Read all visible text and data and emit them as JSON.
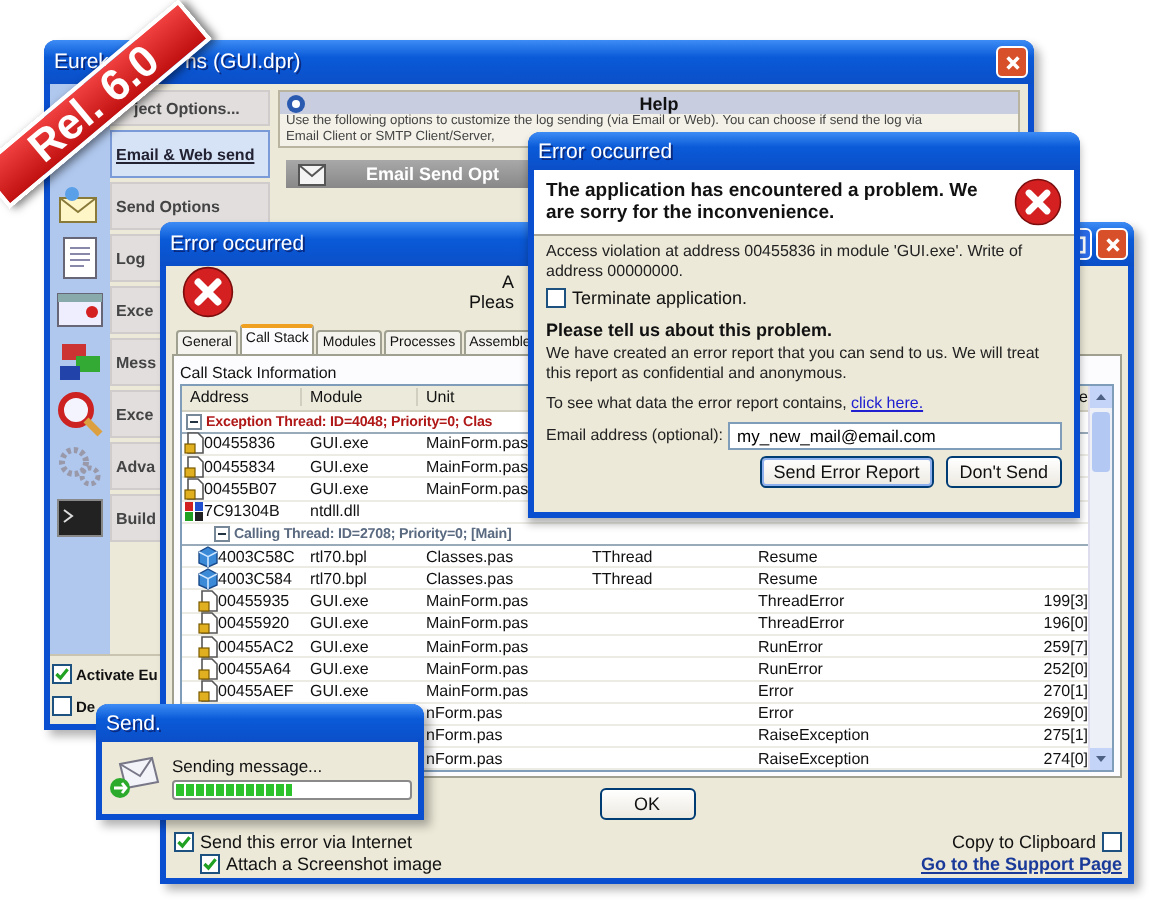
{
  "badge": {
    "text": "Rel. 6.0"
  },
  "options_window": {
    "title_parts": [
      "Eurek",
      "ns (GUI.dpr)"
    ],
    "nav": [
      {
        "label": "ject Options...",
        "selected": false
      },
      {
        "label": "Email & Web send",
        "selected": true
      },
      {
        "label": "Send Options",
        "selected": false
      },
      {
        "label": "Log",
        "selected": false
      },
      {
        "label": "Exce",
        "selected": false
      },
      {
        "label": "Mess",
        "selected": false
      },
      {
        "label": "Exce",
        "selected": false
      },
      {
        "label": "Adva",
        "selected": false
      },
      {
        "label": "Build",
        "selected": false
      }
    ],
    "help": {
      "title": "Help",
      "lines": [
        "Use the following options to customize the log sending (via Email or Web). You can choose if send the log via",
        "Email Client or SMTP Client/Server,"
      ]
    },
    "section_title": "Email Send Opt",
    "options": [
      {
        "label": "Activate Eu",
        "checked": true
      },
      {
        "label": "De",
        "checked": false
      }
    ]
  },
  "error_window": {
    "title": "Error occurred",
    "message_fragments": [
      "A",
      "Pleas"
    ],
    "tabs": [
      {
        "label": "General",
        "selected": false
      },
      {
        "label": "Call Stack",
        "selected": true
      },
      {
        "label": "Modules",
        "selected": false
      },
      {
        "label": "Processes",
        "selected": false
      },
      {
        "label": "Assemble",
        "selected": false
      }
    ],
    "section_label": "Call Stack Information",
    "columns": {
      "address": "Address",
      "module": "Module",
      "unit": "Unit",
      "column_6": "e"
    },
    "threads": [
      {
        "kind": "exception",
        "label": "Exception Thread: ID=4048; Priority=0; Clas",
        "expanded": true,
        "frames": [
          {
            "kind": "exe",
            "address": "00455836",
            "module": "GUI.exe",
            "unit": "MainForm.pas"
          },
          {
            "kind": "exe",
            "address": "00455834",
            "module": "GUI.exe",
            "unit": "MainForm.pas"
          },
          {
            "kind": "exe",
            "address": "00455B07",
            "module": "GUI.exe",
            "unit": "MainForm.pas"
          },
          {
            "kind": "dll",
            "address": "7C91304B",
            "module": "ntdll.dll"
          }
        ]
      },
      {
        "kind": "calling",
        "label": "Calling Thread: ID=2708; Priority=0; [Main]",
        "expanded": true,
        "frames": [
          {
            "kind": "bpl",
            "address": "4003C58C",
            "module": "rtl70.bpl",
            "unit": "Classes.pas",
            "column_4": "TThread",
            "column_5": "Resume"
          },
          {
            "kind": "bpl",
            "address": "4003C584",
            "module": "rtl70.bpl",
            "unit": "Classes.pas",
            "column_4": "TThread",
            "column_5": "Resume"
          },
          {
            "kind": "exe",
            "address": "00455935",
            "module": "GUI.exe",
            "unit": "MainForm.pas",
            "column_5": "ThreadError",
            "column_6": "199[3]"
          },
          {
            "kind": "exe",
            "address": "00455920",
            "module": "GUI.exe",
            "unit": "MainForm.pas",
            "column_5": "ThreadError",
            "column_6": "196[0]"
          },
          {
            "kind": "exe",
            "address": "00455AC2",
            "module": "GUI.exe",
            "unit": "MainForm.pas",
            "column_5": "RunError",
            "column_6": "259[7]"
          },
          {
            "kind": "exe",
            "address": "00455A64",
            "module": "GUI.exe",
            "unit": "MainForm.pas",
            "column_5": "RunError",
            "column_6": "252[0]"
          },
          {
            "kind": "exe",
            "address": "00455AEF",
            "module": "GUI.exe",
            "unit": "MainForm.pas",
            "column_5": "Error",
            "column_6": "270[1]"
          },
          {
            "unit": "nForm.pas",
            "column_5": "Error",
            "column_6": "269[0]"
          },
          {
            "unit": "nForm.pas",
            "column_5": "RaiseException",
            "column_6": "275[1]"
          },
          {
            "unit": "nForm.pas",
            "column_5": "RaiseException",
            "column_6": "274[0]"
          }
        ]
      }
    ],
    "ok_button": "OK",
    "send_option": {
      "label": "Send this error via Internet",
      "checked": true,
      "children": [
        {
          "label": "Attach a Screenshot image",
          "checked": true
        }
      ]
    },
    "copy_option": {
      "label": "Copy to Clipboard",
      "checked": false
    },
    "support_link": "Go to the Support Page"
  },
  "error_dialog": {
    "title": "Error occurred",
    "headline": "The application has encountered a problem. We are sorry for the inconvenience.",
    "details": "Access violation at address 00455836 in module 'GUI.exe'. Write of address 00000000.",
    "terminate": {
      "label": "Terminate application.",
      "checked": false
    },
    "ask_title": "Please tell us about this problem.",
    "ask_text": "We have created an error report that you can send to us. We will treat this report as confidential and anonymous.",
    "report_prompt": "To see what data the error report contains,",
    "report_link": "click here.",
    "email": {
      "label": "Email address (optional):",
      "value": "my_new_mail@email.com"
    },
    "buttons": [
      "Send Error Report",
      "Don't Send"
    ]
  },
  "send_window": {
    "title": "Send.",
    "status": "Sending message...",
    "level": 0.5
  }
}
